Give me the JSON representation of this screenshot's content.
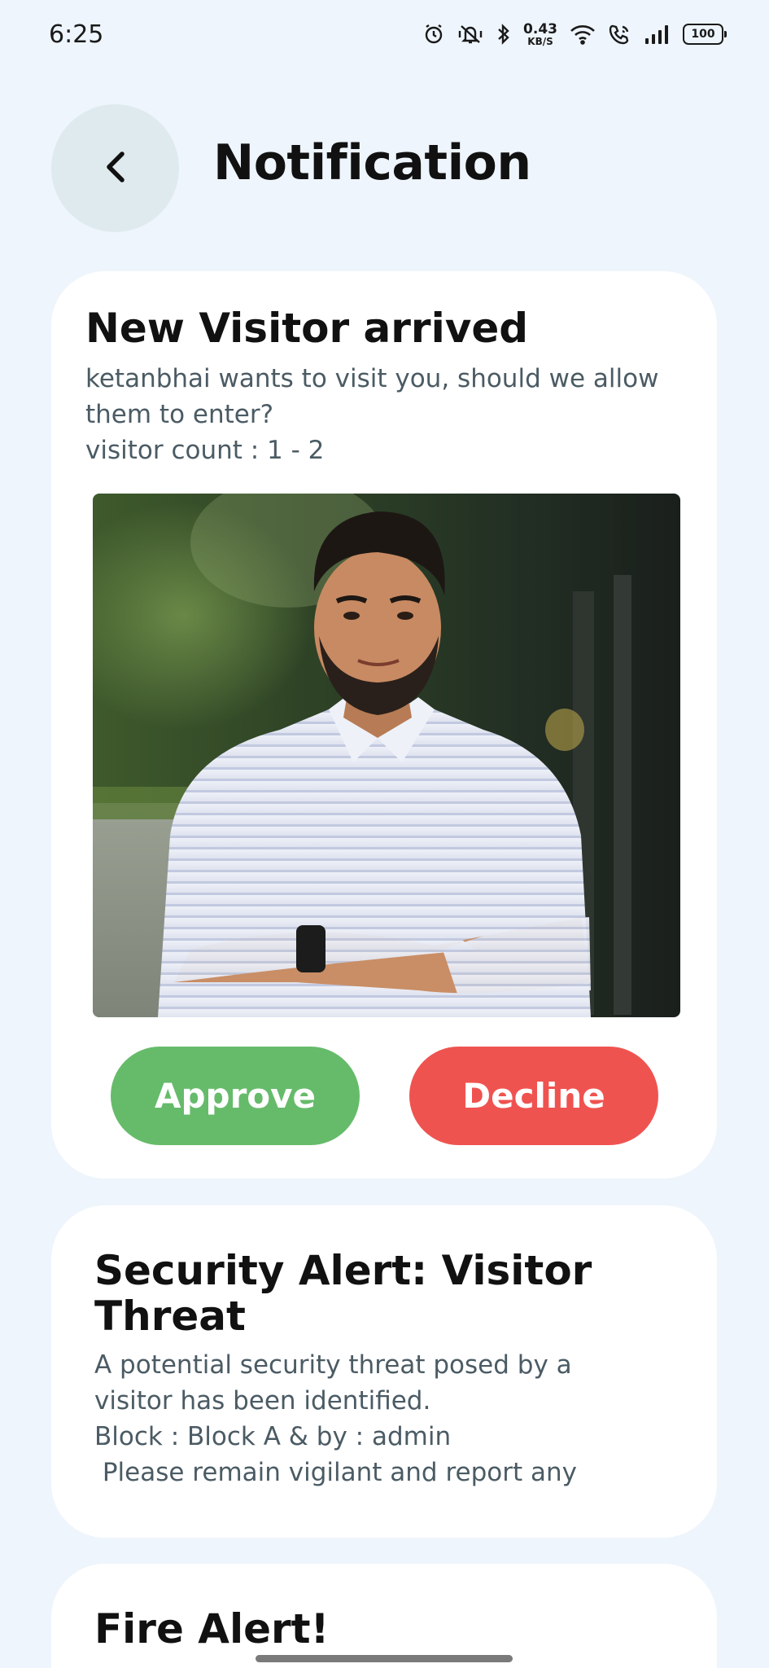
{
  "status_bar": {
    "time": "6:25",
    "net_speed_value": "0.43",
    "net_speed_unit": "KB/S",
    "battery": "100",
    "icons": [
      "alarm-icon",
      "vibrate-icon",
      "bluetooth-icon",
      "wifi-icon",
      "wifi-call-icon",
      "signal-icon",
      "battery-icon"
    ]
  },
  "header": {
    "title": "Notification",
    "back_icon": "chevron-left-icon"
  },
  "notifications": [
    {
      "title": "New Visitor arrived",
      "lines": [
        "ketanbhai wants to visit you, should we allow",
        "them to enter?",
        "visitor count : 1 - 2"
      ],
      "approve_label": "Approve",
      "decline_label": "Decline"
    },
    {
      "title": "Security Alert: Visitor Threat",
      "lines": [
        "A potential security threat posed by a",
        "visitor has been identified.",
        "Block : Block A & by : admin",
        " Please remain vigilant and report any"
      ]
    },
    {
      "title": "Fire Alert!"
    }
  ],
  "colors": {
    "background": "#eef5fc",
    "approve": "#66bb6a",
    "decline": "#ef5350",
    "back_button": "#dfeaef",
    "body_text": "#4b5b64"
  }
}
